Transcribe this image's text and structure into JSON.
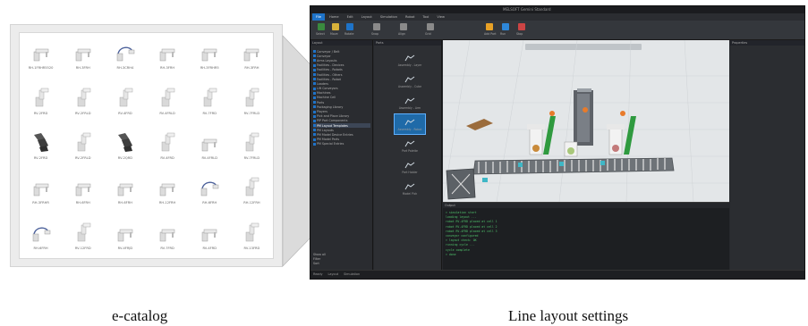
{
  "captions": {
    "left": "e-catalog",
    "right": "Line layout settings"
  },
  "catalog": {
    "items": [
      {
        "caption": "RH-1FRHR5520",
        "icon": "scara-robot-icon"
      },
      {
        "caption": "RH-3FRH",
        "icon": "scara-robot-icon"
      },
      {
        "caption": "RH-3CRH4",
        "icon": "scara-robot-cable-icon"
      },
      {
        "caption": "RH-3FRH",
        "icon": "scara-robot-icon"
      },
      {
        "caption": "RH-3FRHR5",
        "icon": "scara-robot-icon"
      },
      {
        "caption": "RH-3FRH",
        "icon": "scara-robot-icon"
      },
      {
        "caption": "RV-2FRD",
        "icon": "vertical-robot-icon"
      },
      {
        "caption": "RV-2FRLD",
        "icon": "vertical-robot-icon"
      },
      {
        "caption": "RV-4FRD",
        "icon": "vertical-robot-icon"
      },
      {
        "caption": "RV-4FRLD",
        "icon": "vertical-robot-icon"
      },
      {
        "caption": "RV-7FRD",
        "icon": "vertical-robot-icon"
      },
      {
        "caption": "RV-7FRLD",
        "icon": "vertical-robot-icon"
      },
      {
        "caption": "RV-2FRD",
        "icon": "dark-robot-icon"
      },
      {
        "caption": "RV-2FRLD",
        "icon": "vertical-robot-icon"
      },
      {
        "caption": "RV-2QRD",
        "icon": "dark-robot-icon"
      },
      {
        "caption": "RV-4FRD",
        "icon": "vertical-robot-icon"
      },
      {
        "caption": "RV-4FRLD",
        "icon": "scara-robot-icon"
      },
      {
        "caption": "RV-7FRLD",
        "icon": "vertical-robot-icon"
      },
      {
        "caption": "RH-3FRHR",
        "icon": "scara-robot-icon"
      },
      {
        "caption": "RH-6FRH",
        "icon": "scara-robot-icon"
      },
      {
        "caption": "RH-6FRH",
        "icon": "scara-robot-icon"
      },
      {
        "caption": "RH-12FRH",
        "icon": "scara-robot-icon"
      },
      {
        "caption": "RH-6FRH",
        "icon": "scara-robot-cable-icon"
      },
      {
        "caption": "RH-12FRH",
        "icon": "vertical-robot-icon"
      },
      {
        "caption": "RH-6FRH",
        "icon": "scara-robot-cable-icon"
      },
      {
        "caption": "RV-12FRD",
        "icon": "vertical-robot-icon"
      },
      {
        "caption": "RV-4FRJD",
        "icon": "scara-robot-icon"
      },
      {
        "caption": "RV-7FRD",
        "icon": "scara-robot-icon"
      },
      {
        "caption": "RV-4FRD",
        "icon": "scara-robot-icon"
      },
      {
        "caption": "RV-13FRD",
        "icon": "vertical-robot-icon"
      }
    ]
  },
  "app": {
    "title": "MELSOFT Gemini Standard",
    "ribbon_tabs": [
      "File",
      "Home",
      "Edit",
      "Layout",
      "Simulation",
      "Robot",
      "Tool",
      "View"
    ],
    "ribbon_labels": [
      "Select",
      "Move",
      "Rotate",
      "Snap",
      "Align",
      "Grid",
      "Add Part",
      "Run",
      "Stop"
    ],
    "left_pane_title": "Layout",
    "tree_items": [
      "Conveyor / Belt",
      "Conveyor",
      "Arms Layouts",
      "Facilities - Devices",
      "Facilities - Robots",
      "Facilities - Others",
      "Facilities - Robot",
      "Loaders",
      "Lift Conveyors",
      "Machines",
      "Machine Cell",
      "Parts",
      "Packaging Library",
      "Players",
      "Pick and Place Library",
      "PIP Part Components",
      "PM Layout Templates",
      "PM Layouts",
      "PM Model Device Entries",
      "PM Model Parts",
      "PM Special Entries"
    ],
    "tree_selected_index": 16,
    "left_options": [
      "Show all",
      "Filter",
      "Sort"
    ],
    "mid_pane_title": "Parts",
    "parts": [
      {
        "label": "Assembly - Layer",
        "icon": "assembly-layer-icon"
      },
      {
        "label": "Assembly - Cube",
        "icon": "assembly-cube-icon"
      },
      {
        "label": "Assembly - Arm",
        "icon": "robot-arm-icon"
      },
      {
        "label": "Assembly - Robot",
        "icon": "robot-arm-icon"
      },
      {
        "label": "Part Palette",
        "icon": "palette-icon"
      },
      {
        "label": "Part Holder",
        "icon": "holder-icon"
      },
      {
        "label": "Model Pick",
        "icon": "pick-icon"
      }
    ],
    "parts_selected_index": 3,
    "right_pane_title": "Properties",
    "output_title": "Output",
    "log_lines": [
      "> simulation start",
      "  loading layout ...",
      "  robot RV-4FRD placed at cell 1",
      "  robot RV-4FRD placed at cell 2",
      "  robot RV-4FRD placed at cell 3",
      "  conveyor configured",
      "> layout check: OK",
      "  running cycle ...",
      "  cycle complete",
      "> done"
    ],
    "status": [
      "Ready",
      "Layout",
      "Simulation"
    ]
  }
}
